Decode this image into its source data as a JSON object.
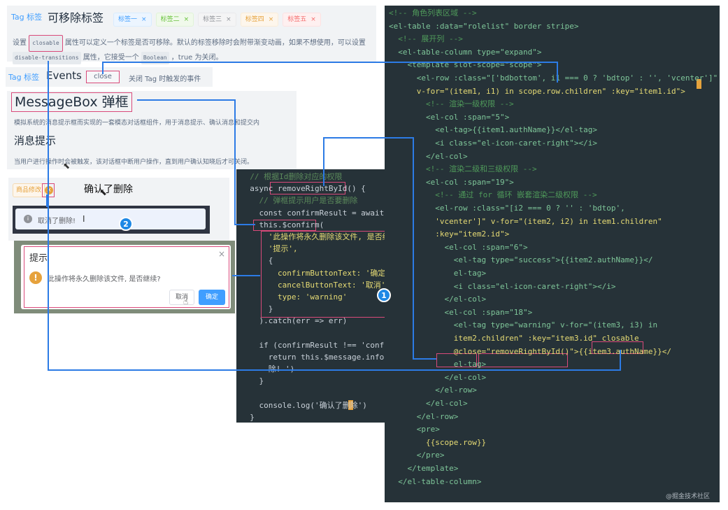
{
  "tags_panel": {
    "tab_label": "Tag 标签",
    "title": "可移除标签",
    "pills": [
      "标签一",
      "标签二",
      "标签三",
      "标签四",
      "标签五"
    ],
    "pill_close": "×",
    "desc_prefix": "设置",
    "closable_chip": "closable",
    "desc_mid": "属性可以定义一个标签是否可移除。默认的标签移除时会附带渐变动画，如果不想使用，可以设置",
    "disable_chip": "disable-transitions",
    "desc_mid2": "属性，它接受一个",
    "boolean_chip": "Boolean",
    "desc_end": "，true 为关闭。"
  },
  "events_panel": {
    "tab_label": "Tag 标签",
    "title": "Events",
    "close_label": "close",
    "close_desc": "关闭 Tag 时触发的事件"
  },
  "messagebox_panel": {
    "title": "MessageBox 弹框",
    "desc": "模拟系统的消息提示框而实现的一套模态对话框组件，用于消息提示、确认消息和提交内",
    "sub_title": "消息提示",
    "sub_desc": "当用户进行操作时会被触发，该对话框中断用户操作，直到用户确认知晓后才可关闭。"
  },
  "demo_panel": {
    "tag_label": "商品修改",
    "confirm_text": "确认了删除",
    "cancel_message": "取消了删除!",
    "cursor_mark": "I"
  },
  "dialog": {
    "title": "提示",
    "close": "×",
    "message": "此操作将永久删除该文件, 是否继续?",
    "cancel_label": "取消",
    "confirm_label": "确定"
  },
  "badges": [
    "1",
    "2"
  ],
  "watermark": "@掘金技术社区",
  "left_code": [
    "  // 根据Id删除对应的权限",
    "  async removeRightById() {",
    "    // 弹框提示用户是否要删除",
    "    const confirmResult = await",
    "    this.$confirm(",
    "      '此操作将永久删除该文件, 是否继续?',",
    "      '提示',",
    "      {",
    "        confirmButtonText: '确定',",
    "        cancelButtonText: '取消',",
    "        type: 'warning'",
    "      }",
    "    ).catch(err => err)",
    "",
    "    if (confirmResult !== 'confirm') {",
    "      return this.$message.info('取消了删",
    "      除! ')",
    "    }",
    "",
    "    console.log('确认了删除')",
    "  }"
  ],
  "right_code": [
    "<!-- 角色列表区域 -->",
    "<el-table :data=\"rolelist\" border stripe>",
    "  <!-- 展开列 -->",
    "  <el-table-column type=\"expand\">",
    "    <template slot-scope=\"scope\">",
    "      <el-row :class=\"['bdbottom', i1 === 0 ? 'bdtop' : '', 'vcenter']\"",
    "      v-for=\"(item1, i1) in scope.row.children\" :key=\"item1.id\">",
    "        <!-- 渲染一级权限 -->",
    "        <el-col :span=\"5\">",
    "          <el-tag>{{item1.authName}}</el-tag>",
    "          <i class=\"el-icon-caret-right\"></i>",
    "        </el-col>",
    "        <!-- 渲染二级和三级权限 -->",
    "        <el-col :span=\"19\">",
    "          <!-- 通过 for 循环 嵌套渲染二级权限 -->",
    "          <el-row :class=\"[i2 === 0 ? '' : 'bdtop',",
    "          'vcenter']\" v-for=\"(item2, i2) in item1.children\"",
    "          :key=\"item2.id\">",
    "            <el-col :span=\"6\">",
    "              <el-tag type=\"success\">{{item2.authName}}</",
    "              el-tag>",
    "              <i class=\"el-icon-caret-right\"></i>",
    "            </el-col>",
    "            <el-col :span=\"18\">",
    "              <el-tag type=\"warning\" v-for=\"(item3, i3) in",
    "              item2.children\" :key=\"item3.id\" closable",
    "              @close=\"removeRightById()\">{{item3.authName}}</",
    "              el-tag>",
    "            </el-col>",
    "          </el-row>",
    "        </el-col>",
    "      </el-row>",
    "      <pre>",
    "        {{scope.row}}",
    "      </pre>",
    "    </template>",
    "  </el-table-column>"
  ],
  "colors": {
    "code_bg": "#263238",
    "highlight": "#d94a7a",
    "arrow": "#2c7be5",
    "warning": "#e6a23c",
    "primary": "#409eff"
  }
}
